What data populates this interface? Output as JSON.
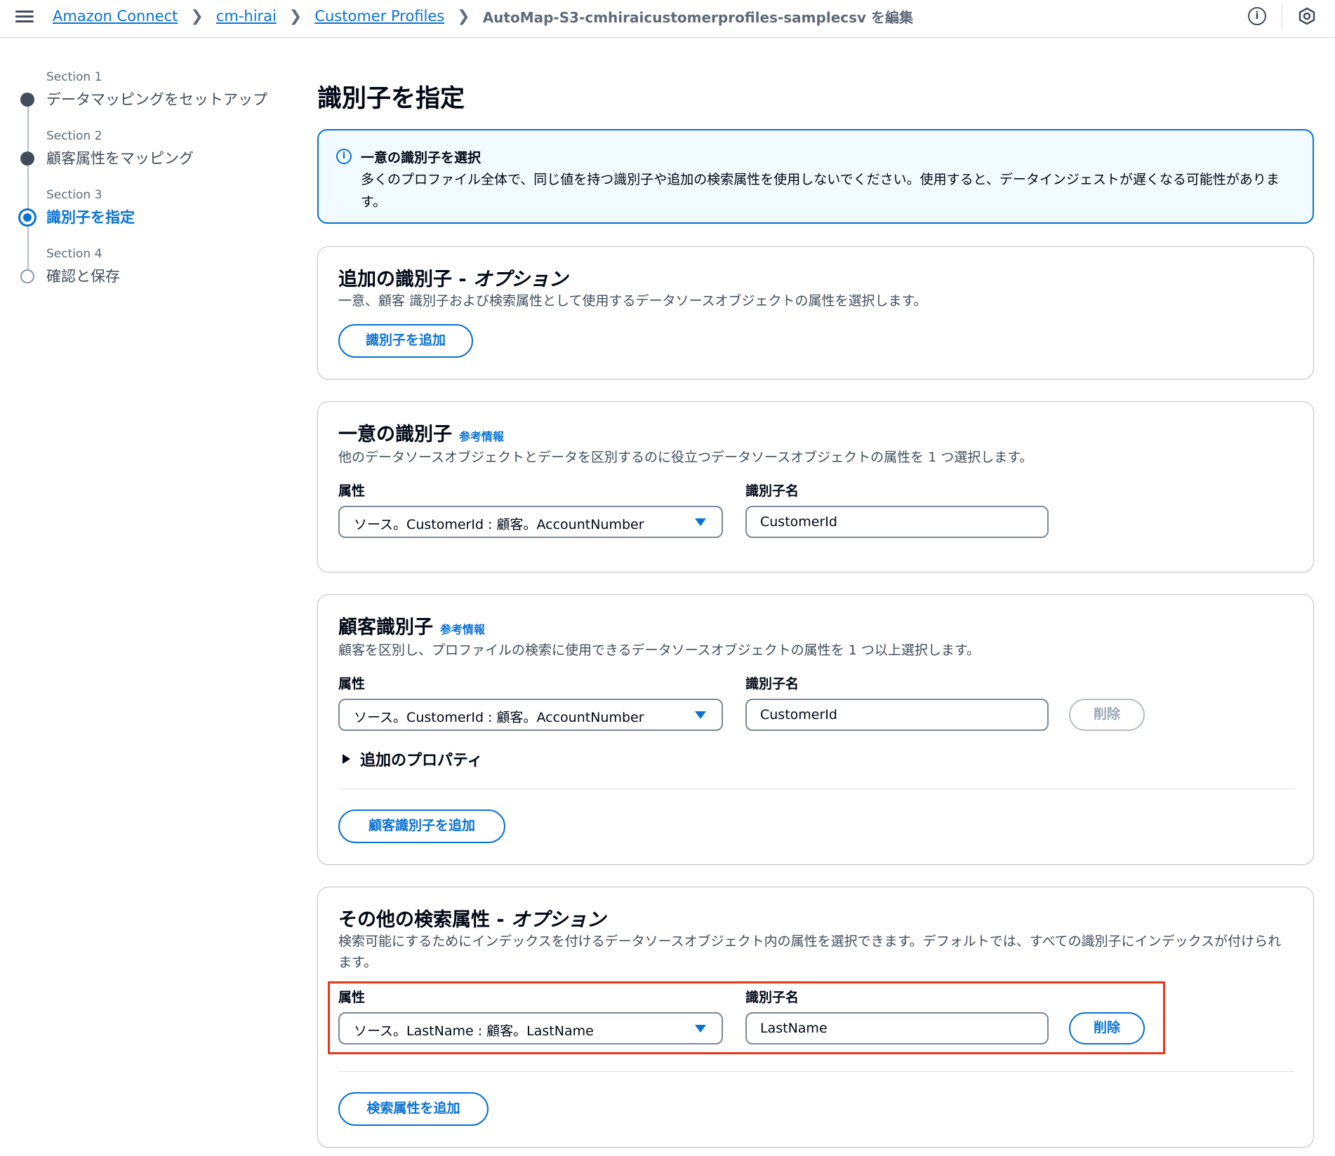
{
  "breadcrumb": {
    "items": [
      "Amazon Connect",
      "cm-hirai",
      "Customer Profiles"
    ],
    "current": "AutoMap-S3-cmhiraicustomerprofiles-samplecsv を編集"
  },
  "topbar": {
    "info_glyph": "i"
  },
  "steps": [
    {
      "num": "Section 1",
      "label": "データマッピングをセットアップ",
      "state": "done"
    },
    {
      "num": "Section 2",
      "label": "顧客属性をマッピング",
      "state": "done"
    },
    {
      "num": "Section 3",
      "label": "識別子を指定",
      "state": "active"
    },
    {
      "num": "Section 4",
      "label": "確認と保存",
      "state": "todo"
    }
  ],
  "page_title": "識別子を指定",
  "alert": {
    "title": "一意の識別子を選択",
    "text": "多くのプロファイル全体で、同じ値を持つ識別子や追加の検索属性を使用しないでください。使用すると、データインジェストが遅くなる可能性があります。"
  },
  "additional_identifiers": {
    "title": "追加の識別子 - ",
    "title_opt": "オプション",
    "desc": "一意、顧客 識別子および検索属性として使用するデータソースオブジェクトの属性を選択します。",
    "add_button": "識別子を追加"
  },
  "unique_identifier": {
    "title": "一意の識別子",
    "info": "参考情報",
    "desc": "他のデータソースオブジェクトとデータを区別するのに役立つデータソースオブジェクトの属性を 1 つ選択します。",
    "attr_label": "属性",
    "attr_value": "ソース。CustomerId : 顧客。AccountNumber",
    "name_label": "識別子名",
    "name_value": "CustomerId"
  },
  "customer_identifier": {
    "title": "顧客識別子",
    "info": "参考情報",
    "desc": "顧客を区別し、プロファイルの検索に使用できるデータソースオブジェクトの属性を 1 つ以上選択します。",
    "attr_label": "属性",
    "attr_value": "ソース。CustomerId : 顧客。AccountNumber",
    "name_label": "識別子名",
    "name_value": "CustomerId",
    "delete_button": "削除",
    "expander": "追加のプロパティ",
    "add_button": "顧客識別子を追加"
  },
  "search_attributes": {
    "title": "その他の検索属性 - ",
    "title_opt": "オプション",
    "desc": "検索可能にするためにインデックスを付けるデータソースオブジェクト内の属性を選択できます。デフォルトでは、すべての識別子にインデックスが付けられます。",
    "attr_label": "属性",
    "attr_value": "ソース。LastName : 顧客。LastName",
    "name_label": "識別子名",
    "name_value": "LastName",
    "delete_button": "削除",
    "add_button": "検索属性を追加"
  },
  "colors": {
    "accent": "#0972d3",
    "highlight": "#e8361a",
    "alert_bg": "#f2fbff"
  }
}
